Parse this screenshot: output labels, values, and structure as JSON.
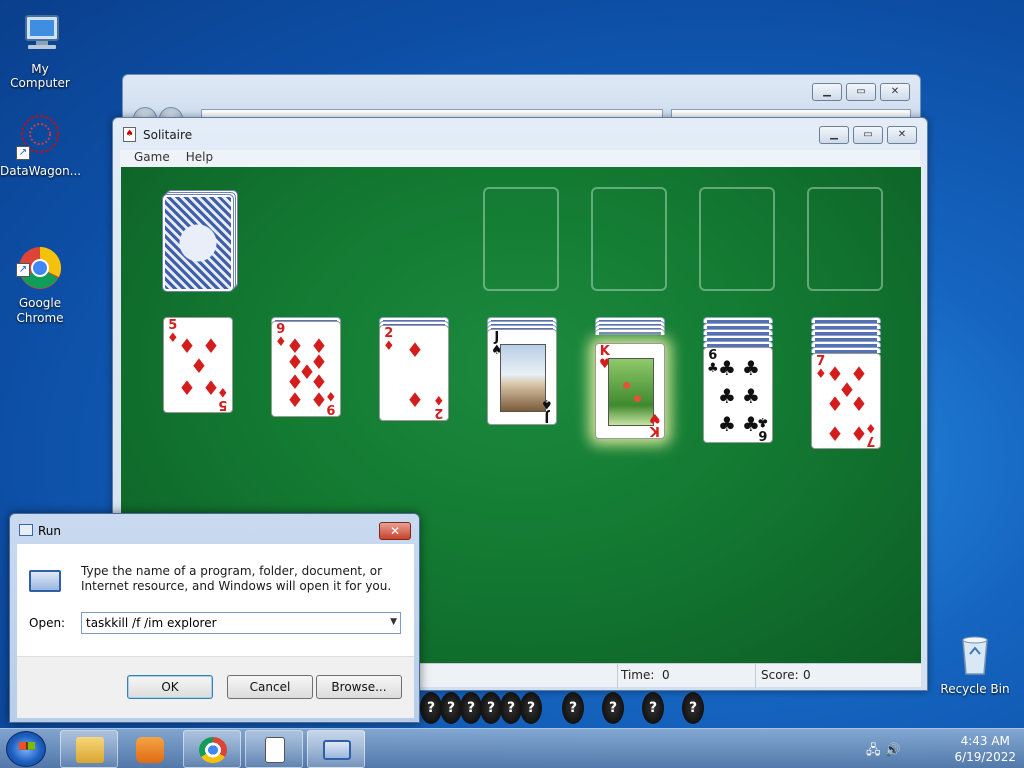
{
  "desktop": {
    "icons": [
      {
        "label": "My Computer"
      },
      {
        "label": "DataWagon..."
      },
      {
        "label": "Google\nChrome"
      },
      {
        "label": "Recycle Bin"
      }
    ]
  },
  "solitaire": {
    "title": "Solitaire",
    "menu": [
      "Game",
      "Help"
    ],
    "status": {
      "time_label": "Time:",
      "time_value": "0",
      "score_label": "Score:",
      "score_value": "0"
    },
    "tableau": [
      {
        "rank": "5",
        "suit": "♦",
        "color": "red"
      },
      {
        "rank": "9",
        "suit": "♦",
        "color": "red"
      },
      {
        "rank": "2",
        "suit": "♦",
        "color": "red"
      },
      {
        "rank": "J",
        "suit": "♠",
        "color": "black"
      },
      {
        "rank": "K",
        "suit": "♥",
        "color": "red"
      },
      {
        "rank": "6",
        "suit": "♣",
        "color": "black"
      },
      {
        "rank": "7",
        "suit": "♦",
        "color": "red"
      }
    ]
  },
  "run_dialog": {
    "title": "Run",
    "close_label": "✕",
    "description": "Type the name of a program, folder, document, or Internet resource, and Windows will open it for you.",
    "open_label": "Open:",
    "open_value": "taskkill /f /im explorer",
    "ok_label": "OK",
    "cancel_label": "Cancel",
    "browse_label": "Browse..."
  },
  "game_strip": [
    "?",
    "?",
    "?",
    "?",
    "?",
    "?",
    "?",
    "?",
    "?",
    "?",
    "?"
  ],
  "taskbar": {
    "time": "4:43 AM",
    "date": "6/19/2022"
  }
}
